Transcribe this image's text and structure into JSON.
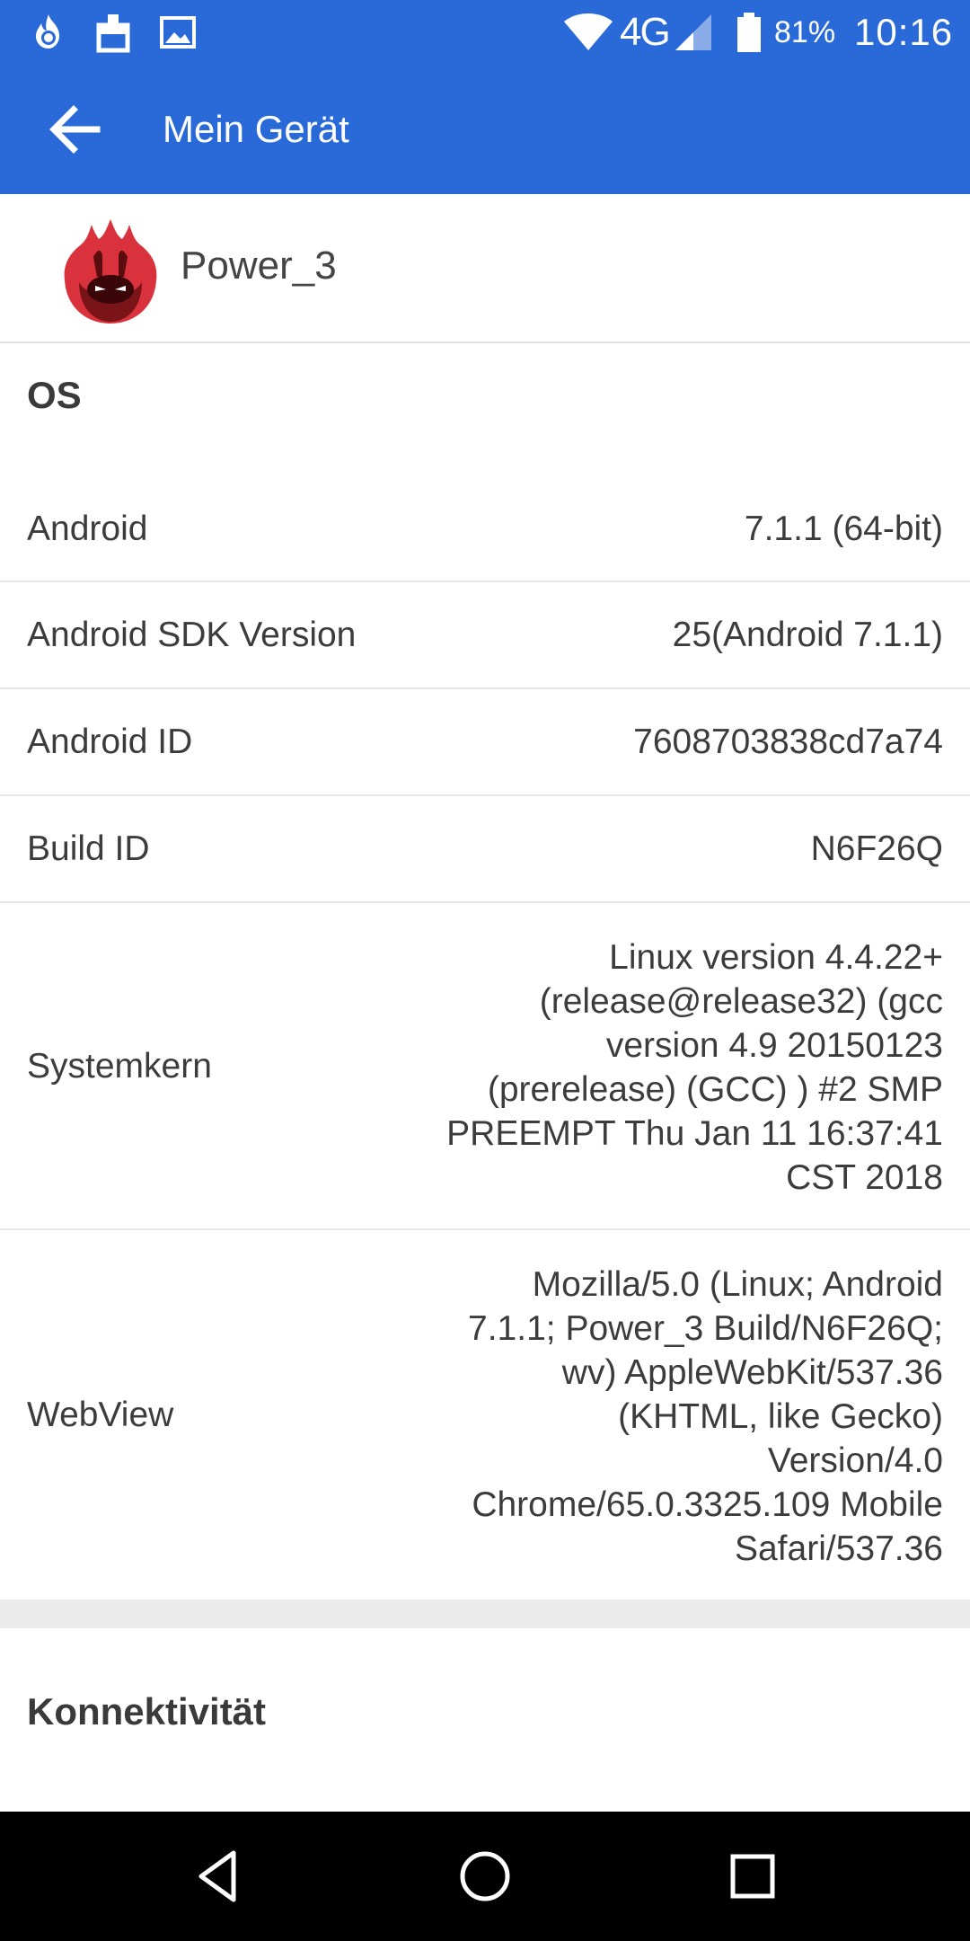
{
  "status_bar": {
    "network": "4G",
    "battery_percent": "81%",
    "time": "10:16",
    "icons": [
      "flame-notification-icon",
      "cleaner-notification-icon",
      "image-notification-icon",
      "wifi-icon",
      "signal-icon",
      "battery-icon"
    ]
  },
  "toolbar": {
    "title": "Mein Gerät",
    "back_icon": "arrow-back-icon"
  },
  "device": {
    "name": "Power_3",
    "logo_icon": "antutu-logo-icon"
  },
  "os_section": {
    "title": "OS",
    "rows": [
      {
        "label": "Android",
        "value": "7.1.1 (64-bit)"
      },
      {
        "label": "Android SDK Version",
        "value": "25(Android 7.1.1)"
      },
      {
        "label": "Android ID",
        "value": "7608703838cd7a74"
      },
      {
        "label": "Build ID",
        "value": "N6F26Q"
      },
      {
        "label": "Systemkern",
        "value": "Linux version 4.4.22+ (release@release32) (gcc version 4.9 20150123 (prerelease) (GCC) ) #2 SMP PREEMPT Thu Jan 11 16:37:41 CST 2018"
      },
      {
        "label": "WebView",
        "value": "Mozilla/5.0 (Linux; Android 7.1.1; Power_3 Build/N6F26Q; wv) AppleWebKit/537.36 (KHTML, like Gecko) Version/4.0 Chrome/65.0.3325.109 Mobile Safari/537.36"
      }
    ]
  },
  "connectivity_section": {
    "title": "Konnektivität"
  },
  "nav_bar": {
    "icons": [
      "back-triangle-icon",
      "home-circle-icon",
      "recents-square-icon"
    ]
  },
  "colors": {
    "appbar": "#2a6ad8",
    "navbar": "#000000",
    "divider": "#e6e6e6",
    "section_gap": "#ebebeb",
    "text": "#3c3c3c"
  }
}
